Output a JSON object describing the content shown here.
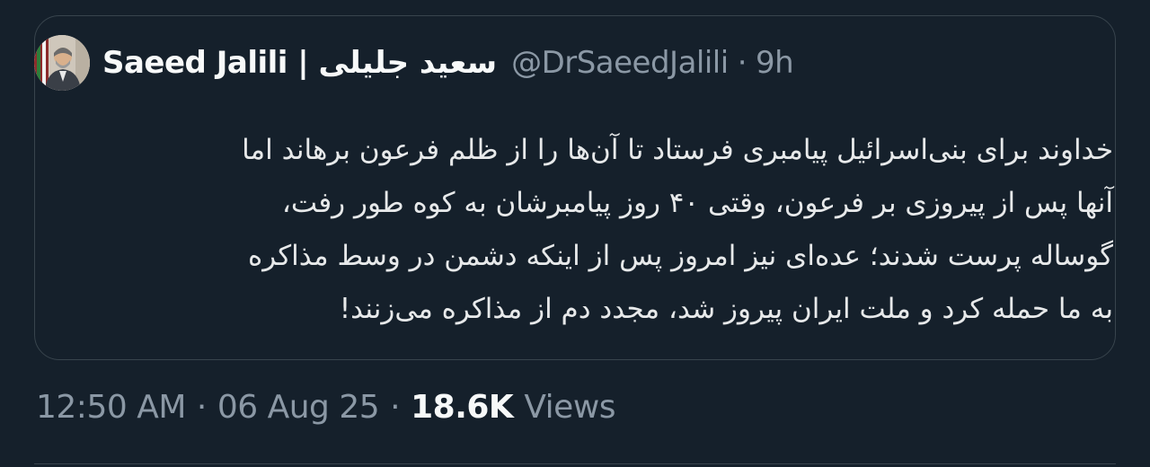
{
  "quoted_tweet": {
    "author": {
      "display_name": "Saeed Jalili | سعید جلیلی",
      "handle": "@DrSaeedJalili",
      "time_ago": "9h",
      "avatar_icon": "profile-photo"
    },
    "separator": "·",
    "text_lines": [
      "خداوند برای بنی‌اسرائیل پیامبری فرستاد تا آن‌ها را از ظلم فرعون برهاند اما",
      "آنها پس از پیروزی بر فرعون، وقتی ۴۰ روز پیامبرشان به کوه طور رفت،",
      "گوساله پرست شدند؛ عده‌ای نیز امروز پس از اینکه دشمن در وسط مذاکره",
      "به ما حمله کرد و ملت ایران پیروز شد، مجدد دم از مذاکره می‌زنند!"
    ]
  },
  "post_meta": {
    "time": "12:50 AM",
    "date": "06 Aug 25",
    "separator": "·",
    "views_count": "18.6K",
    "views_label": "Views"
  },
  "colors": {
    "background": "#15202b",
    "border": "#38444d",
    "text_primary": "#e7e9ea",
    "text_secondary": "#8b98a5"
  }
}
